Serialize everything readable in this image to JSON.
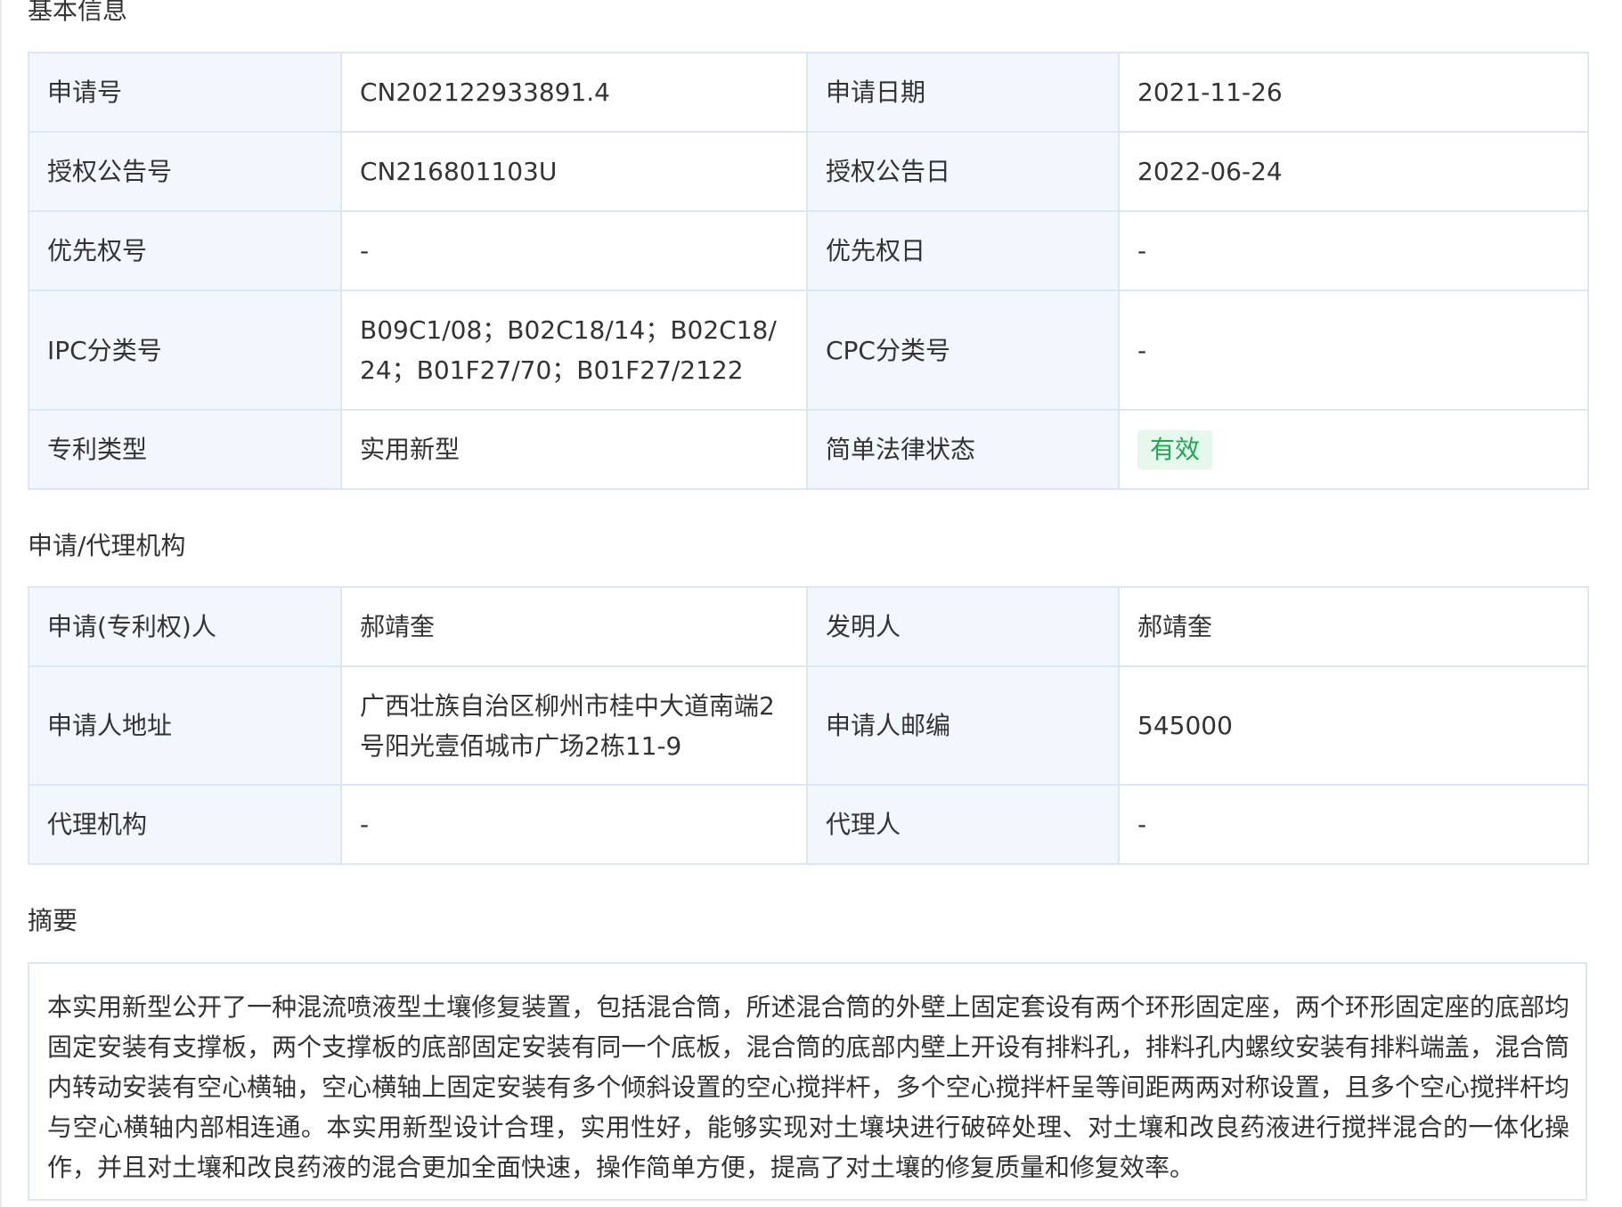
{
  "sections": {
    "basic_info": "基本信息",
    "applicant_agency": "申请/代理机构",
    "abstract": "摘要"
  },
  "basic": {
    "application_no": {
      "label": "申请号",
      "value": "CN202122933891.4"
    },
    "application_date": {
      "label": "申请日期",
      "value": "2021-11-26"
    },
    "grant_pub_no": {
      "label": "授权公告号",
      "value": "CN216801103U"
    },
    "grant_pub_date": {
      "label": "授权公告日",
      "value": "2022-06-24"
    },
    "priority_no": {
      "label": "优先权号",
      "value": "-"
    },
    "priority_date": {
      "label": "优先权日",
      "value": "-"
    },
    "ipc": {
      "label": "IPC分类号",
      "value": "B09C1/08；B02C18/14；B02C18/24；B01F27/70；B01F27/2122"
    },
    "cpc": {
      "label": "CPC分类号",
      "value": "-"
    },
    "patent_type": {
      "label": "专利类型",
      "value": "实用新型"
    },
    "legal_status": {
      "label": "简单法律状态",
      "value": "有效"
    }
  },
  "applicant": {
    "patentee": {
      "label": "申请(专利权)人",
      "value": "郝靖奎"
    },
    "inventor": {
      "label": "发明人",
      "value": "郝靖奎"
    },
    "address": {
      "label": "申请人地址",
      "value": "广西壮族自治区柳州市桂中大道南端2号阳光壹佰城市广场2栋11-9"
    },
    "postcode": {
      "label": "申请人邮编",
      "value": "545000"
    },
    "agency": {
      "label": "代理机构",
      "value": "-"
    },
    "agent": {
      "label": "代理人",
      "value": "-"
    }
  },
  "abstract": {
    "text": "本实用新型公开了一种混流喷液型土壤修复装置，包括混合筒，所述混合筒的外壁上固定套设有两个环形固定座，两个环形固定座的底部均固定安装有支撑板，两个支撑板的底部固定安装有同一个底板，混合筒的底部内壁上开设有排料孔，排料孔内螺纹安装有排料端盖，混合筒内转动安装有空心横轴，空心横轴上固定安装有多个倾斜设置的空心搅拌杆，多个空心搅拌杆呈等间距两两对称设置，且多个空心搅拌杆均与空心横轴内部相连通。本实用新型设计合理，实用性好，能够实现对土壤块进行破碎处理、对土壤和改良药液进行搅拌混合的一体化操作，并且对土壤和改良药液的混合更加全面快速，操作简单方便，提高了对土壤的修复质量和修复效率。"
  },
  "colors": {
    "label_bg": "#f2f7fd",
    "border": "#dde7f3",
    "status_green": "#21a855",
    "status_bg": "#e6f7ec"
  }
}
